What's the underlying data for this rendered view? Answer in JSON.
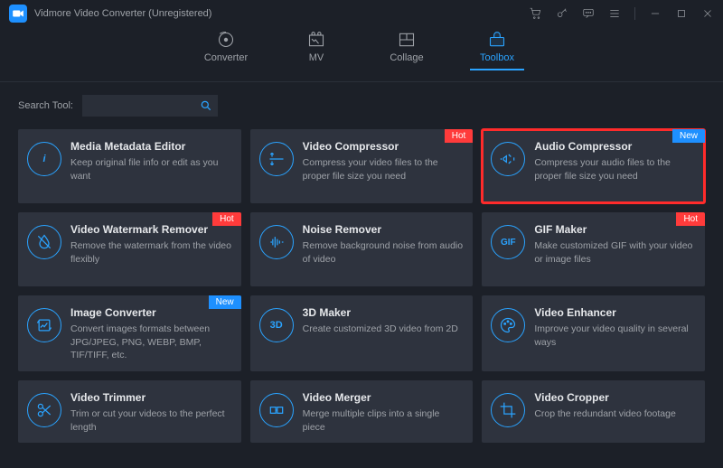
{
  "app": {
    "title": "Vidmore Video Converter (Unregistered)"
  },
  "tabs": [
    {
      "id": "converter",
      "label": "Converter"
    },
    {
      "id": "mv",
      "label": "MV"
    },
    {
      "id": "collage",
      "label": "Collage"
    },
    {
      "id": "toolbox",
      "label": "Toolbox"
    }
  ],
  "search": {
    "label": "Search Tool:",
    "value": ""
  },
  "badges": {
    "hot": "Hot",
    "new": "New"
  },
  "tools": {
    "media_metadata_editor": {
      "title": "Media Metadata Editor",
      "desc": "Keep original file info or edit as you want"
    },
    "video_compressor": {
      "title": "Video Compressor",
      "desc": "Compress your video files to the proper file size you need",
      "badge": "hot"
    },
    "audio_compressor": {
      "title": "Audio Compressor",
      "desc": "Compress your audio files to the proper file size you need",
      "badge": "new"
    },
    "video_watermark_remover": {
      "title": "Video Watermark Remover",
      "desc": "Remove the watermark from the video flexibly",
      "badge": "hot"
    },
    "noise_remover": {
      "title": "Noise Remover",
      "desc": "Remove background noise from audio of video"
    },
    "gif_maker": {
      "title": "GIF Maker",
      "desc": "Make customized GIF with your video or image files",
      "badge": "hot"
    },
    "image_converter": {
      "title": "Image Converter",
      "desc": "Convert images formats between JPG/JPEG, PNG, WEBP, BMP, TIF/TIFF, etc.",
      "badge": "new"
    },
    "3d_maker": {
      "title": "3D Maker",
      "desc": "Create customized 3D video from 2D"
    },
    "video_enhancer": {
      "title": "Video Enhancer",
      "desc": "Improve your video quality in several ways"
    },
    "video_trimmer": {
      "title": "Video Trimmer",
      "desc": "Trim or cut your videos to the perfect length"
    },
    "video_merger": {
      "title": "Video Merger",
      "desc": "Merge multiple clips into a single piece"
    },
    "video_cropper": {
      "title": "Video Cropper",
      "desc": "Crop the redundant video footage"
    }
  },
  "colors": {
    "accent": "#2aa3ff",
    "hot": "#ff3b3b",
    "new": "#1e90ff",
    "highlight": "#ff2b2b"
  }
}
